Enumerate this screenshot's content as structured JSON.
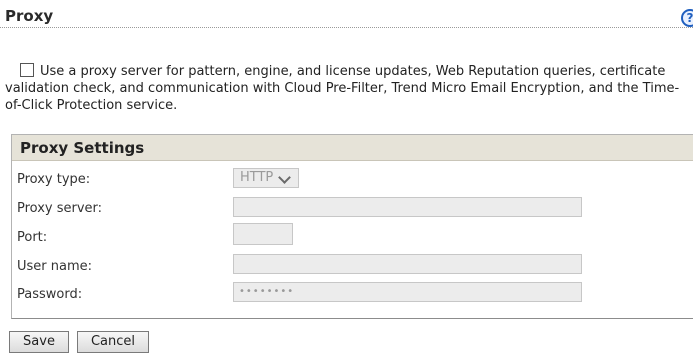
{
  "header": {
    "title": "Proxy",
    "help_icon": "?"
  },
  "proxy_option": {
    "checked": false,
    "label": "Use a proxy server for pattern, engine, and license updates, Web Reputation queries, certificate validation check, and communication with Cloud Pre-Filter, Trend Micro Email Encryption, and the Time-of-Click Protection service."
  },
  "proxy_settings": {
    "title": "Proxy Settings",
    "proxy_type": {
      "label": "Proxy type:",
      "value": "HTTP"
    },
    "proxy_server": {
      "label": "Proxy server:",
      "value": ""
    },
    "port": {
      "label": "Port:",
      "value": ""
    },
    "user_name": {
      "label": "User name:",
      "value": ""
    },
    "password": {
      "label": "Password:",
      "value": "••••••••"
    }
  },
  "buttons": {
    "save": "Save",
    "cancel": "Cancel"
  },
  "colors": {
    "panel_header_bg": "#e6e3d8",
    "field_bg": "#ececec",
    "help_blue": "#1f5fbf"
  }
}
